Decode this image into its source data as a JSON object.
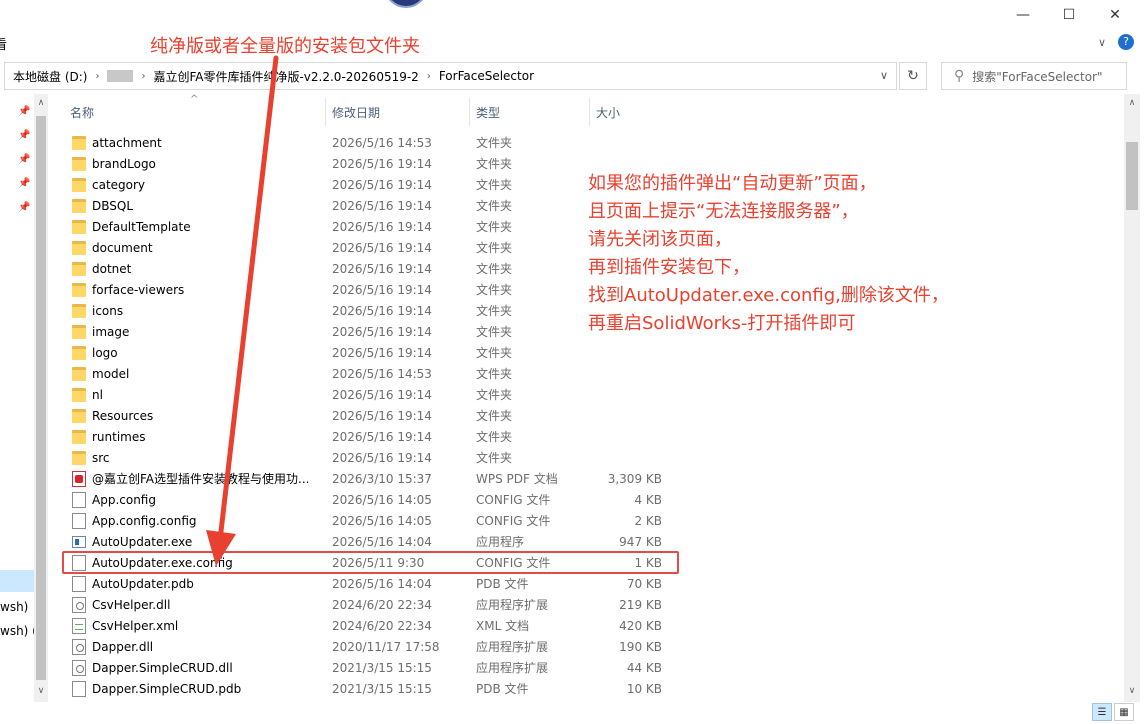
{
  "window": {
    "minimize_glyph": "—",
    "maximize_glyph": "☐",
    "close_glyph": "✕"
  },
  "ribbon": {
    "left_fragment": "看",
    "help_glyph": "?",
    "expand_glyph": "∨"
  },
  "address": {
    "crumbs": [
      "本地磁盘 (D:)",
      "",
      "嘉立创FA零件库插件纯净版-v2.2.0-20260519-2",
      "ForFaceSelector"
    ],
    "search_placeholder": "搜索\"ForFaceSelector\""
  },
  "columns": {
    "name": "名称",
    "date": "修改日期",
    "type": "类型",
    "size": "大小"
  },
  "nav": {
    "items": [
      "wsh) ",
      "wsh) ("
    ]
  },
  "files": [
    {
      "name": "attachment",
      "date": "2026/5/16 14:53",
      "type": "文件夹",
      "size": "",
      "icon": "folder"
    },
    {
      "name": "brandLogo",
      "date": "2026/5/16 19:14",
      "type": "文件夹",
      "size": "",
      "icon": "folder"
    },
    {
      "name": "category",
      "date": "2026/5/16 19:14",
      "type": "文件夹",
      "size": "",
      "icon": "folder"
    },
    {
      "name": "DBSQL",
      "date": "2026/5/16 19:14",
      "type": "文件夹",
      "size": "",
      "icon": "folder"
    },
    {
      "name": "DefaultTemplate",
      "date": "2026/5/16 19:14",
      "type": "文件夹",
      "size": "",
      "icon": "folder"
    },
    {
      "name": "document",
      "date": "2026/5/16 19:14",
      "type": "文件夹",
      "size": "",
      "icon": "folder"
    },
    {
      "name": "dotnet",
      "date": "2026/5/16 19:14",
      "type": "文件夹",
      "size": "",
      "icon": "folder"
    },
    {
      "name": "forface-viewers",
      "date": "2026/5/16 19:14",
      "type": "文件夹",
      "size": "",
      "icon": "folder"
    },
    {
      "name": "icons",
      "date": "2026/5/16 19:14",
      "type": "文件夹",
      "size": "",
      "icon": "folder"
    },
    {
      "name": "image",
      "date": "2026/5/16 19:14",
      "type": "文件夹",
      "size": "",
      "icon": "folder"
    },
    {
      "name": "logo",
      "date": "2026/5/16 19:14",
      "type": "文件夹",
      "size": "",
      "icon": "folder"
    },
    {
      "name": "model",
      "date": "2026/5/16 14:53",
      "type": "文件夹",
      "size": "",
      "icon": "folder"
    },
    {
      "name": "nl",
      "date": "2026/5/16 19:14",
      "type": "文件夹",
      "size": "",
      "icon": "folder"
    },
    {
      "name": "Resources",
      "date": "2026/5/16 19:14",
      "type": "文件夹",
      "size": "",
      "icon": "folder"
    },
    {
      "name": "runtimes",
      "date": "2026/5/16 19:14",
      "type": "文件夹",
      "size": "",
      "icon": "folder"
    },
    {
      "name": "src",
      "date": "2026/5/16 19:14",
      "type": "文件夹",
      "size": "",
      "icon": "folder"
    },
    {
      "name": "@嘉立创FA选型插件安装教程与使用功...",
      "date": "2026/3/10 15:37",
      "type": "WPS PDF 文档",
      "size": "3,309 KB",
      "icon": "pdf"
    },
    {
      "name": "App.config",
      "date": "2026/5/16 14:05",
      "type": "CONFIG 文件",
      "size": "4 KB",
      "icon": "file"
    },
    {
      "name": "App.config.config",
      "date": "2026/5/16 14:05",
      "type": "CONFIG 文件",
      "size": "2 KB",
      "icon": "file"
    },
    {
      "name": "AutoUpdater.exe",
      "date": "2026/5/16 14:04",
      "type": "应用程序",
      "size": "947 KB",
      "icon": "exe"
    },
    {
      "name": "AutoUpdater.exe.config",
      "date": "2026/5/11 9:30",
      "type": "CONFIG 文件",
      "size": "1 KB",
      "icon": "file"
    },
    {
      "name": "AutoUpdater.pdb",
      "date": "2026/5/16 14:04",
      "type": "PDB 文件",
      "size": "70 KB",
      "icon": "file"
    },
    {
      "name": "CsvHelper.dll",
      "date": "2024/6/20 22:34",
      "type": "应用程序扩展",
      "size": "219 KB",
      "icon": "dll"
    },
    {
      "name": "CsvHelper.xml",
      "date": "2024/6/20 22:34",
      "type": "XML 文档",
      "size": "420 KB",
      "icon": "xml"
    },
    {
      "name": "Dapper.dll",
      "date": "2020/11/17 17:58",
      "type": "应用程序扩展",
      "size": "190 KB",
      "icon": "dll"
    },
    {
      "name": "Dapper.SimpleCRUD.dll",
      "date": "2021/3/15 15:15",
      "type": "应用程序扩展",
      "size": "44 KB",
      "icon": "dll"
    },
    {
      "name": "Dapper.SimpleCRUD.pdb",
      "date": "2021/3/15 15:15",
      "type": "PDB 文件",
      "size": "10 KB",
      "icon": "file"
    }
  ],
  "annotations": {
    "top_note": "纯净版或者全量版的安装包文件夹",
    "instructions": [
      "如果您的插件弹出“自动更新”页面，",
      "且页面上提示“无法连接服务器”，",
      "请先关闭该页面，",
      "再到插件安装包下，",
      "找到AutoUpdater.exe.config,删除该文件，",
      "再重启SolidWorks-打开插件即可"
    ],
    "accent_color": "#e8412f"
  }
}
